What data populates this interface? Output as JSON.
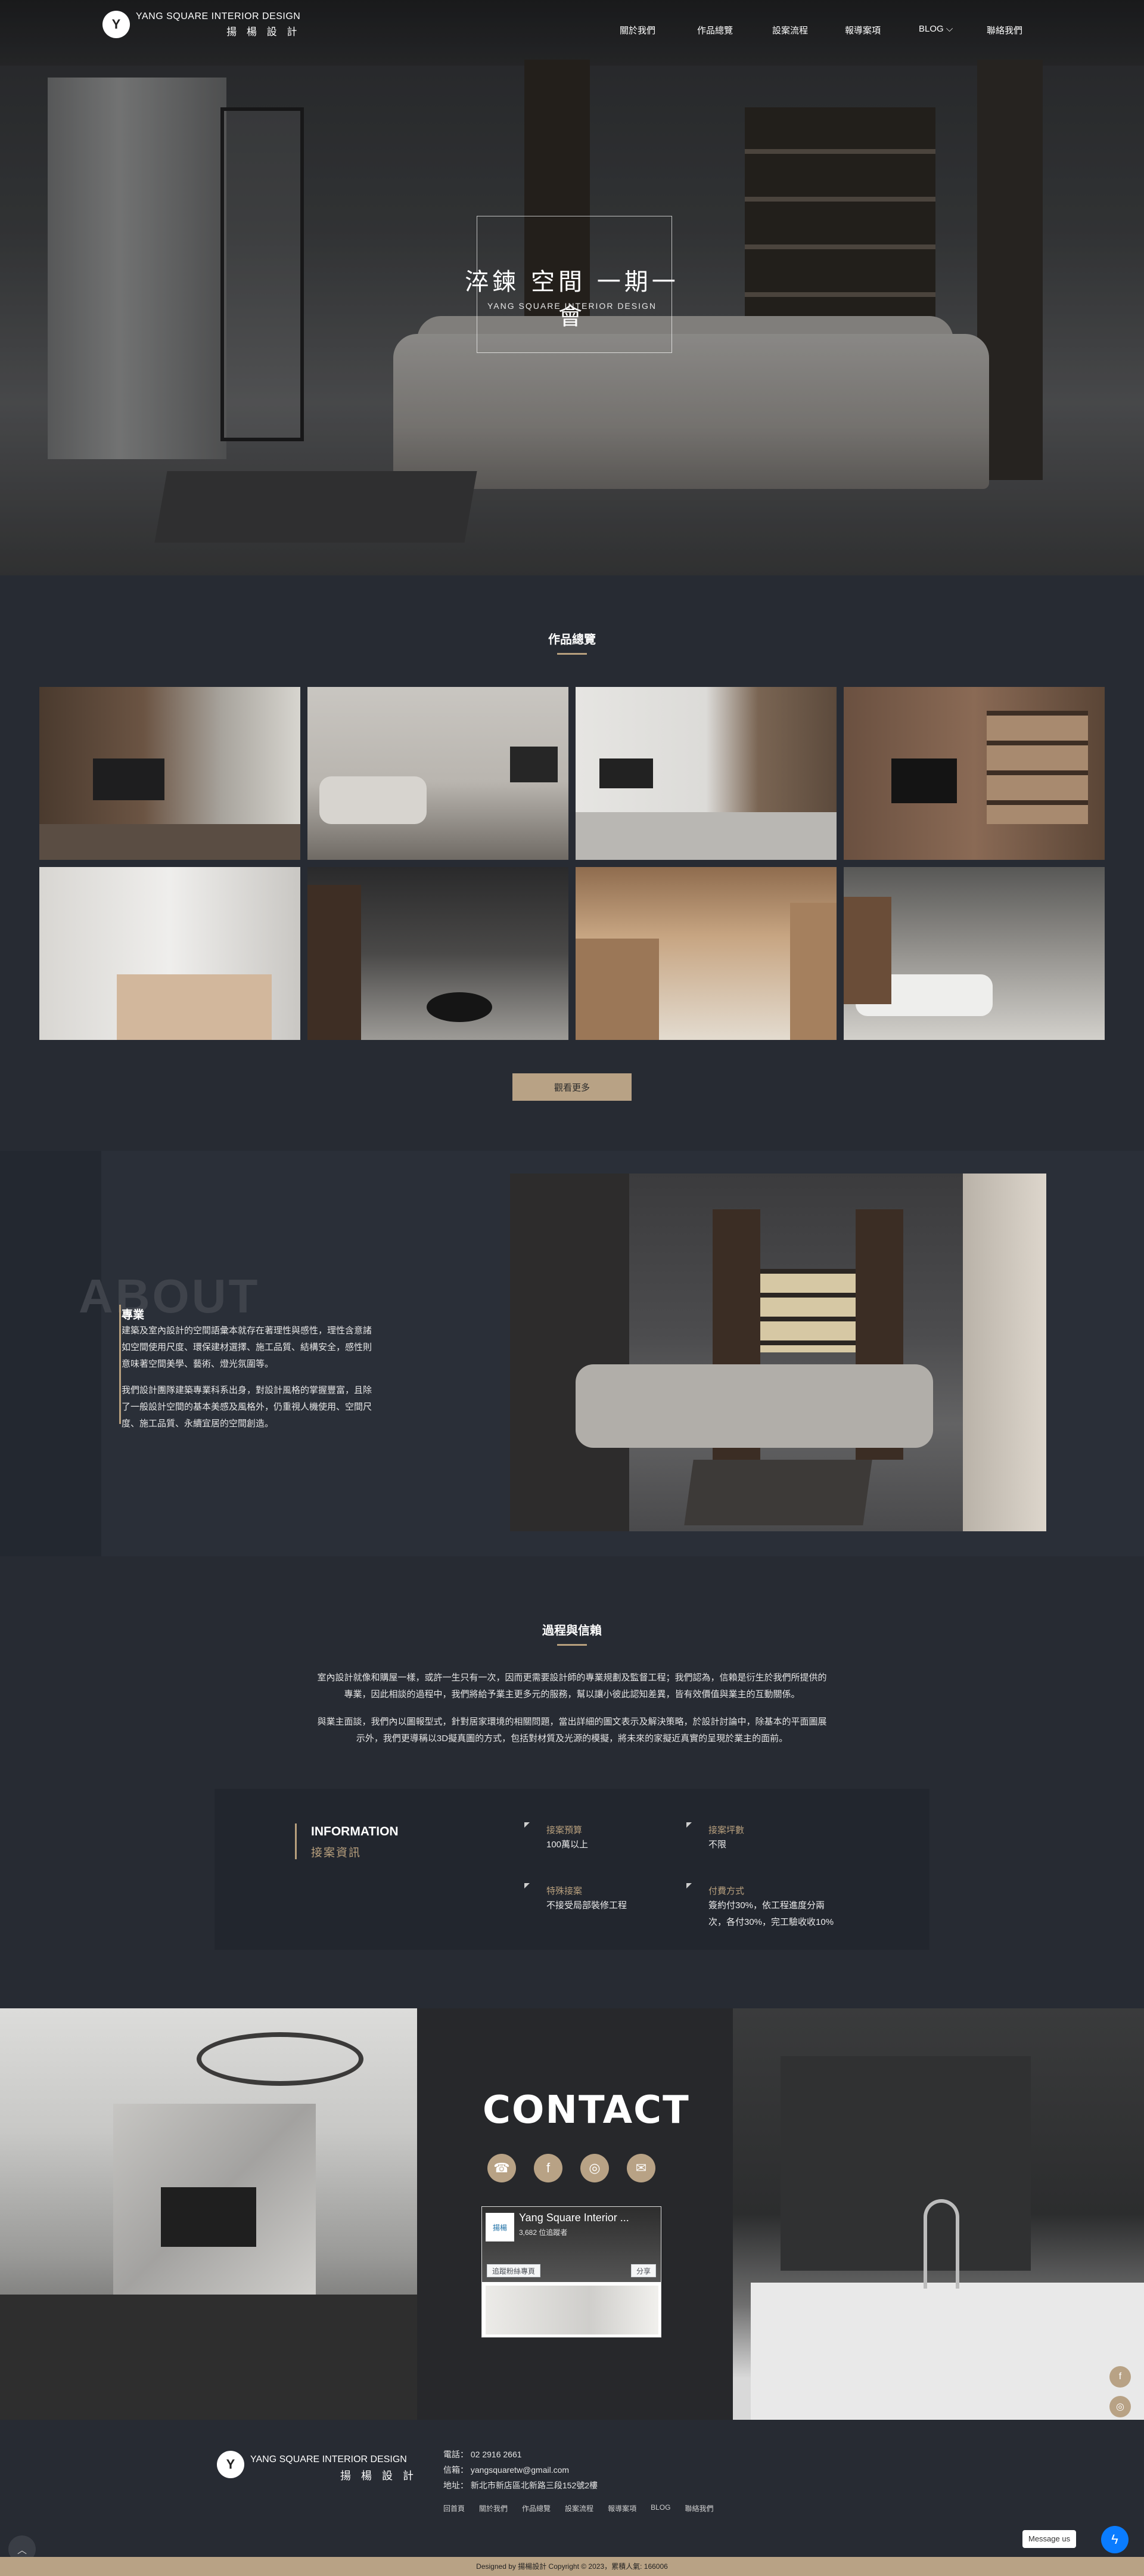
{
  "brand": {
    "en": "YANG SQUARE INTERIOR DESIGN",
    "zh": "揚 楊 設 計",
    "mark": "Y"
  },
  "nav": {
    "items": [
      "關於我們",
      "作品總覽",
      "設案流程",
      "報導案項",
      "BLOG",
      "聯絡我們"
    ],
    "blog_caret": "⌵"
  },
  "hero": {
    "title": "淬鍊 空間  一期一會",
    "subtitle": "YANG SQUARE   INTERIOR DESIGN"
  },
  "works": {
    "title": "作品總覽",
    "more_label": "觀看更多"
  },
  "about": {
    "bg_word": "ABOUT",
    "heading": "專業",
    "p1": [
      "建築及室內設計的空間語彙本就存在著理性與感性，理性含意諸",
      "如空間使用尺度、環保建材選擇、施工品質、結構安全，感性則",
      "意味著空間美學、藝術、燈光氛圍等。"
    ],
    "p2": [
      "我們設計團隊建築專業科系出身，對設計風格的掌握豐富，且除",
      "了一般設計空間的基本美感及風格外，仍重視人機使用、空間尺",
      "度、施工品質、永續宜居的空間創造。"
    ]
  },
  "process": {
    "title": "過程與信賴",
    "p1": [
      "室內設計就像和購屋一樣，或許一生只有一次，因而更需要設計師的專業規劃及監督工程；我們認為，信賴是衍生於我們所提供的",
      "專業，因此相談的過程中，我們將給予業主更多元的服務，幫以讓小彼此認知差異，皆有效價值與業主的互動關係。"
    ],
    "p2": [
      "與業主面談，我們內以圖報型式，針對居家環境的相關問題，當出詳細的圖文表示及解決策略，於設計討論中，除基本的平面圖展",
      "示外，我們更導稱以3D擬真圖的方式，包括對材質及光源的模擬，將未來的家擬近真實的呈現於業主的面前。"
    ]
  },
  "info": {
    "h1": "INFORMATION",
    "h2": "接案資訊",
    "items": [
      {
        "label": "接案預算",
        "value": [
          "100萬以上"
        ]
      },
      {
        "label": "接案坪數",
        "value": [
          "不限"
        ]
      },
      {
        "label": "特殊接案",
        "value": [
          "不接受局部裝修工程"
        ]
      },
      {
        "label": "付費方式",
        "value": [
          "簽約付30%，依工程進度分兩",
          "次，各付30%，完工驗收收10%"
        ]
      }
    ]
  },
  "contact": {
    "title": "CONTACT",
    "icons": [
      "☎",
      "f",
      "◎",
      "✉"
    ],
    "fb": {
      "name": "Yang Square Interior ...",
      "fans": "3,682 位追蹤者",
      "logo": "揚楊",
      "like": "追蹤粉絲專頁",
      "share": "分享"
    }
  },
  "side_icons": [
    "f",
    "◎",
    "☎",
    "✉"
  ],
  "footer": {
    "phone": "電話：  02 2916 2661",
    "email": "信箱：  yangsquaretw@gmail.com",
    "addr": "地址：  新北市新店區北新路三段152號2樓",
    "links": [
      "回首頁",
      "關於我們",
      "作品總覽",
      "設案流程",
      "報導案項",
      "BLOG",
      "聯絡我們"
    ],
    "copyright": "Designed by 揚楊設計 Copyright © 2023，累積人氣: 166006",
    "messenger": "Message us",
    "messenger_icon": "ϟ",
    "top_icon": "︿"
  }
}
